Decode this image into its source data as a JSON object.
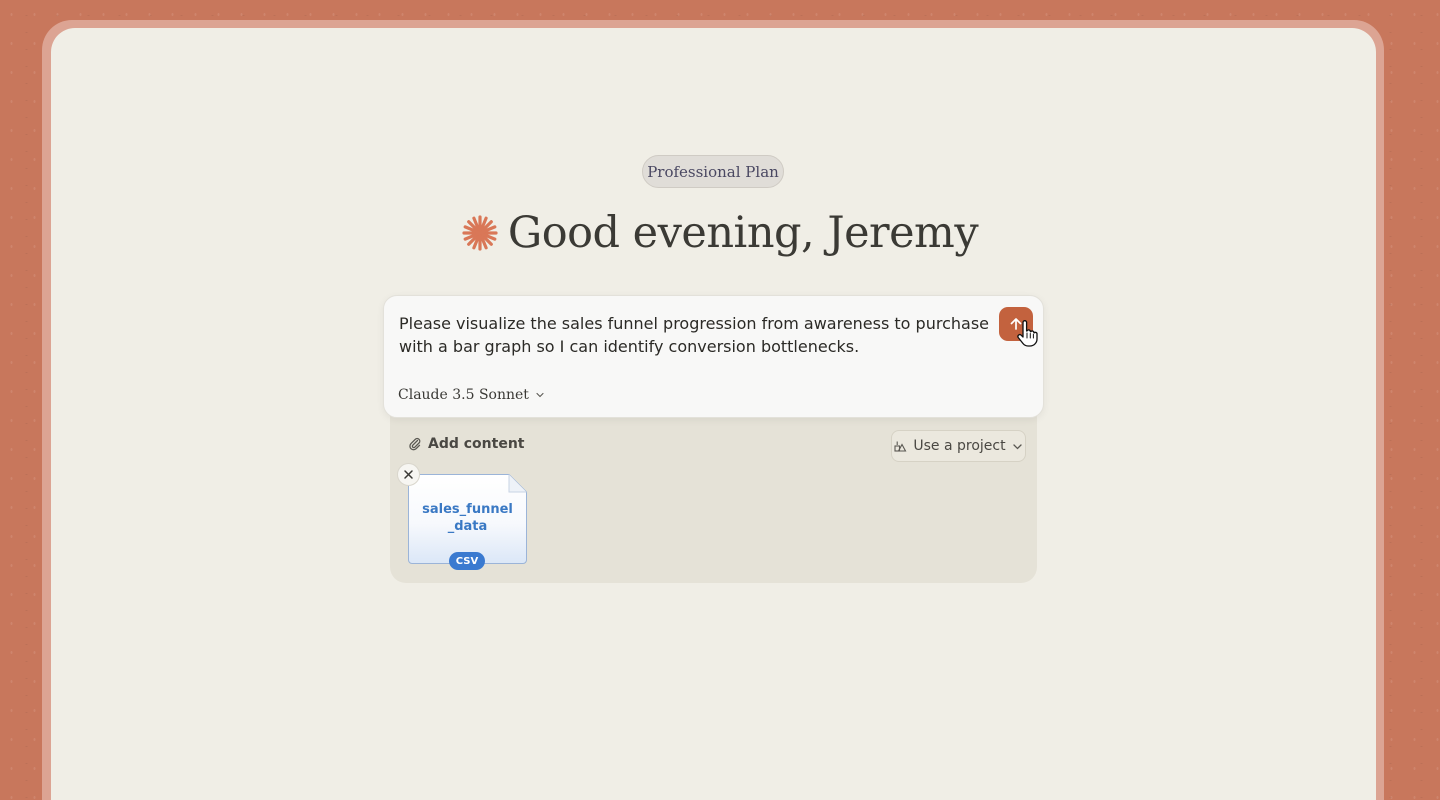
{
  "plan": {
    "label": "Professional Plan"
  },
  "greeting": {
    "text": "Good evening, Jeremy",
    "icon": "claude-spark-icon",
    "icon_color": "#d97757"
  },
  "composer": {
    "prompt": "Please visualize the sales funnel progression from awareness to purchase with a bar graph so I can identify conversion bottlenecks.",
    "model": "Claude 3.5 Sonnet",
    "send_color": "#c3623e"
  },
  "tray": {
    "add_content_label": "Add content",
    "project_label": "Use a project",
    "attachment": {
      "name": "sales_funnel _data",
      "type": "CSV"
    }
  }
}
